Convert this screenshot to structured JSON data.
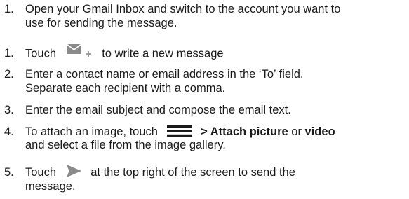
{
  "steps": [
    {
      "number": "1.",
      "line1": "Open your Gmail Inbox and switch to the account you want to",
      "line2": "use for sending the message."
    },
    {
      "number": "1.",
      "before_icon": "Touch",
      "icon": "compose-mail-icon",
      "after_icon": "to write a new message"
    },
    {
      "number": "2.",
      "line1": "Enter a contact name or email address in the ‘To’ field.",
      "line2": "Separate each recipient with a comma."
    },
    {
      "number": "3.",
      "line1": "Enter the email subject and compose the email text."
    },
    {
      "number": "4.",
      "before_icon": "To attach an image, touch",
      "icon": "menu-icon",
      "bold1": "> Attach picture",
      "mid": "or",
      "bold2": "video",
      "line2": "and select a file from the image gallery."
    },
    {
      "number": "5.",
      "before_icon": "Touch",
      "icon": "send-icon",
      "after_icon": "at the top right of the screen to send the",
      "line2": "message."
    }
  ],
  "colors": {
    "text": "#1a1a1a",
    "icon": "#8a8a8a"
  }
}
